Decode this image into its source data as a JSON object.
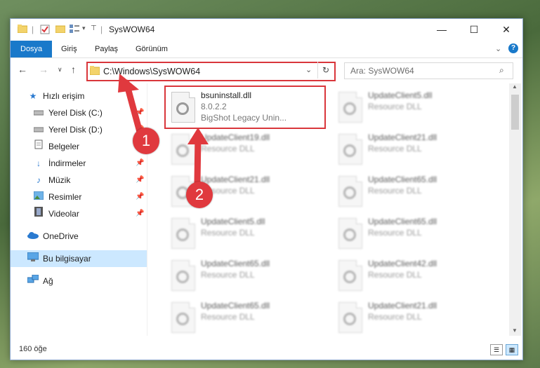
{
  "window": {
    "title": "SysWOW64",
    "qat_separator": "|",
    "qat_dropdown": "▾"
  },
  "ribbon": {
    "tabs": [
      "Dosya",
      "Giriş",
      "Paylaş",
      "Görünüm"
    ]
  },
  "nav": {
    "address": "C:\\Windows\\SysWOW64",
    "search_placeholder": "Ara: SysWOW64"
  },
  "sidebar": {
    "items": [
      {
        "label": "Hızlı erişim",
        "icon": "star-icon"
      },
      {
        "label": "Yerel Disk (C:)",
        "icon": "drive-icon"
      },
      {
        "label": "Yerel Disk (D:)",
        "icon": "drive-icon"
      },
      {
        "label": "Belgeler",
        "icon": "document-icon"
      },
      {
        "label": "İndirmeler",
        "icon": "download-icon"
      },
      {
        "label": "Müzik",
        "icon": "music-icon"
      },
      {
        "label": "Resimler",
        "icon": "pictures-icon"
      },
      {
        "label": "Videolar",
        "icon": "video-icon"
      },
      {
        "label": "OneDrive",
        "icon": "cloud-icon"
      },
      {
        "label": "Bu bilgisayar",
        "icon": "computer-icon"
      },
      {
        "label": "Ağ",
        "icon": "network-icon"
      }
    ]
  },
  "files": {
    "highlighted": {
      "name": "bsuninstall.dll",
      "version": "8.0.2.2",
      "description": "BigShot Legacy Unin..."
    },
    "left": [
      {
        "name": "UpdateClient19.dll",
        "type": "Resource DLL"
      },
      {
        "name": "UpdateClient21.dll",
        "type": "Resource DLL"
      },
      {
        "name": "UpdateClient5.dll",
        "type": "Resource DLL"
      },
      {
        "name": "UpdateClient65.dll",
        "type": "Resource DLL"
      },
      {
        "name": "UpdateClient65.dll",
        "type": "Resource DLL"
      }
    ],
    "right": [
      {
        "name": "UpdateClient5.dll",
        "type": "Resource DLL"
      },
      {
        "name": "UpdateClient21.dll",
        "type": "Resource DLL"
      },
      {
        "name": "UpdateClient65.dll",
        "type": "Resource DLL"
      },
      {
        "name": "UpdateClient65.dll",
        "type": "Resource DLL"
      },
      {
        "name": "UpdateClient42.dll",
        "type": "Resource DLL"
      },
      {
        "name": "UpdateClient21.dll",
        "type": "Resource DLL"
      }
    ]
  },
  "status": {
    "count": "160 öğe"
  },
  "annotations": {
    "step1": "1",
    "step2": "2"
  },
  "colors": {
    "accent": "#1979ca",
    "highlight": "#d9363b",
    "selected": "#cce8ff"
  }
}
